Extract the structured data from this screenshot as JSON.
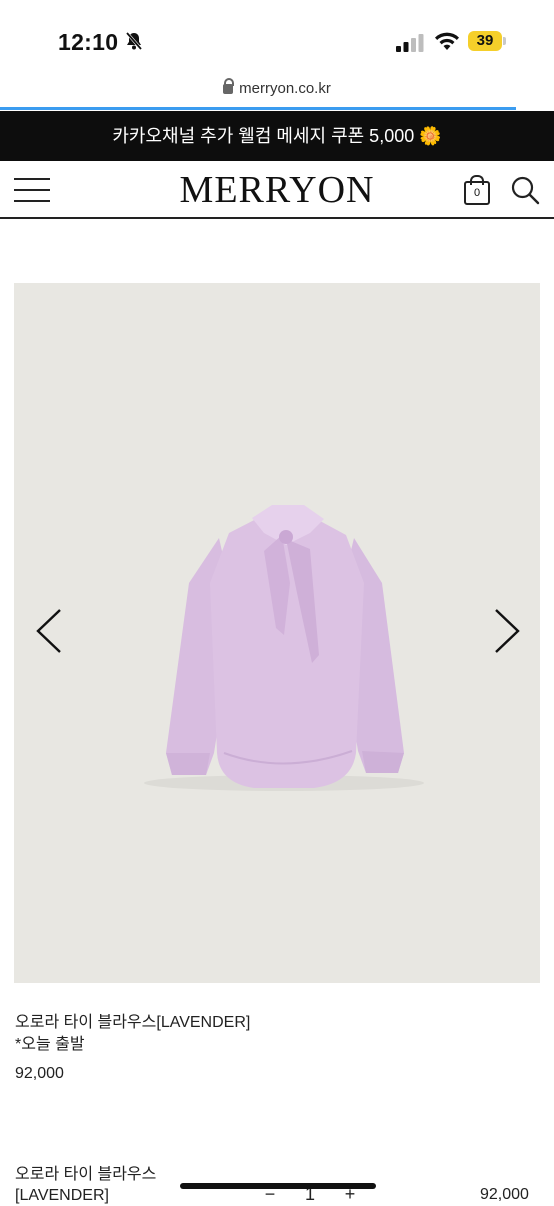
{
  "status": {
    "time": "12:10",
    "battery": "39"
  },
  "browser": {
    "url": "merryon.co.kr"
  },
  "banner": {
    "text": "카카오채널 추가 웰컴 메세지 쿠폰 5,000 🌼"
  },
  "header": {
    "logo": "MERRYON",
    "cart_count": "0"
  },
  "product": {
    "name": "오로라 타이 블라우스[LAVENDER]",
    "note": "*오늘 출발",
    "price": "92,000"
  },
  "sticky_bar": {
    "name": "오로라 타이 블라우스[LAVENDER]",
    "minus": "−",
    "quantity": "1",
    "plus": "+",
    "price": "92,000"
  },
  "icons": {
    "menu": "hamburger-icon",
    "cart": "shopping-bag-icon",
    "search": "search-icon",
    "prev": "chevron-left-icon",
    "next": "chevron-right-icon"
  },
  "colors": {
    "banner_bg": "#0d0d0d",
    "photo_bg": "#e8e7e2",
    "blouse": "#dcc2e3",
    "battery": "#f5cf2a"
  }
}
